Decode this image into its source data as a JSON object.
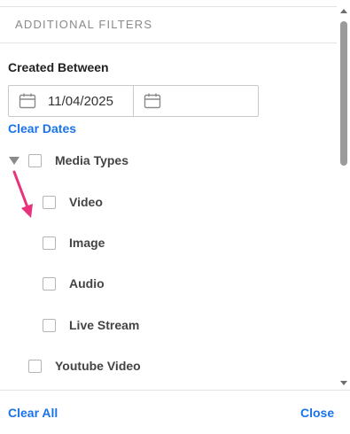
{
  "panel": {
    "section_title": "ADDITIONAL FILTERS"
  },
  "created_between": {
    "label": "Created Between",
    "start_date": "11/04/2025",
    "end_date": "",
    "clear_dates_label": "Clear Dates"
  },
  "media_types": {
    "label": "Media Types",
    "expanded": true,
    "children": [
      {
        "label": "Video",
        "checked": false
      },
      {
        "label": "Image",
        "checked": false
      },
      {
        "label": "Audio",
        "checked": false
      },
      {
        "label": "Live Stream",
        "checked": false
      }
    ]
  },
  "youtube_video": {
    "label": "Youtube Video",
    "checked": false
  },
  "footer": {
    "clear_all_label": "Clear All",
    "close_label": "Close"
  },
  "colors": {
    "link": "#1a73e8",
    "annotation_arrow": "#e8327c"
  },
  "icons": {
    "date_icon": "calendar-icon",
    "tree_toggle": "triangle-down-icon",
    "annotation": "arrow-annotation-icon"
  }
}
